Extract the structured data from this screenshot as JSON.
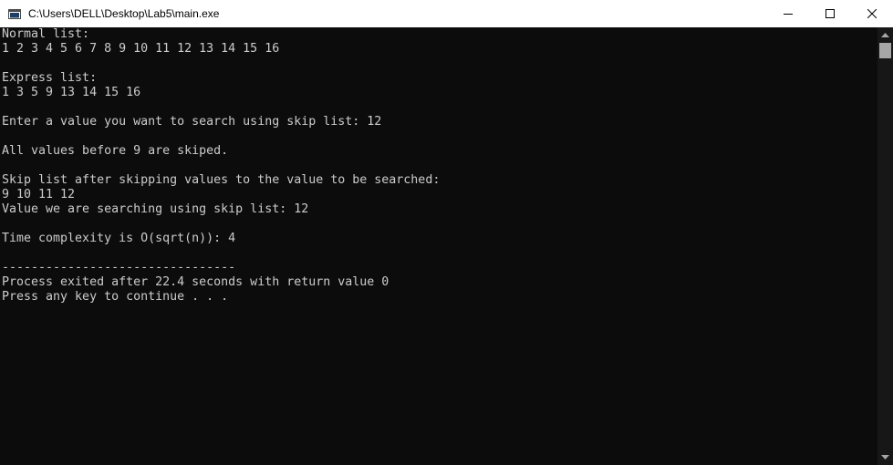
{
  "window": {
    "title": "C:\\Users\\DELL\\Desktop\\Lab5\\main.exe",
    "app_icon": "console-app-icon",
    "controls": [
      "minimize-icon",
      "maximize-icon",
      "close-icon"
    ]
  },
  "console": {
    "lines": [
      "Normal list:",
      "1 2 3 4 5 6 7 8 9 10 11 12 13 14 15 16",
      "",
      "Express list:",
      "1 3 5 9 13 14 15 16",
      "",
      "Enter a value you want to search using skip list: 12",
      "",
      "All values before 9 are skiped.",
      "",
      "Skip list after skipping values to the value to be searched:",
      "9 10 11 12",
      "Value we are searching using skip list: 12",
      "",
      "Time complexity is O(sqrt(n)): 4",
      "",
      "--------------------------------",
      "Process exited after 22.4 seconds with return value 0",
      "Press any key to continue . . ."
    ]
  },
  "colors": {
    "console_bg": "#0c0c0c",
    "console_text": "#cccccc",
    "titlebar_bg": "#ffffff",
    "scrollbar_track": "#171717",
    "scrollbar_thumb": "#a6a6a6"
  }
}
